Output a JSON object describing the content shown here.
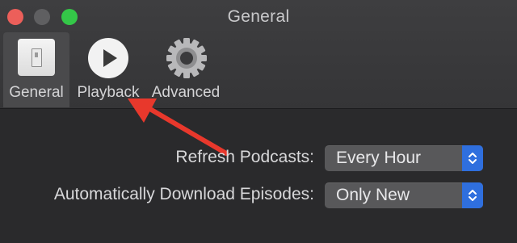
{
  "window": {
    "title": "General"
  },
  "toolbar": {
    "tabs": [
      {
        "label": "General",
        "icon": "general-switch-icon"
      },
      {
        "label": "Playback",
        "icon": "play-icon"
      },
      {
        "label": "Advanced",
        "icon": "gear-icon"
      }
    ]
  },
  "settings": {
    "refresh": {
      "label": "Refresh Podcasts:",
      "value": "Every Hour"
    },
    "download": {
      "label": "Automatically Download Episodes:",
      "value": "Only New"
    }
  },
  "colors": {
    "annotation_arrow": "#e8382c",
    "accent": "#2f6fde"
  }
}
